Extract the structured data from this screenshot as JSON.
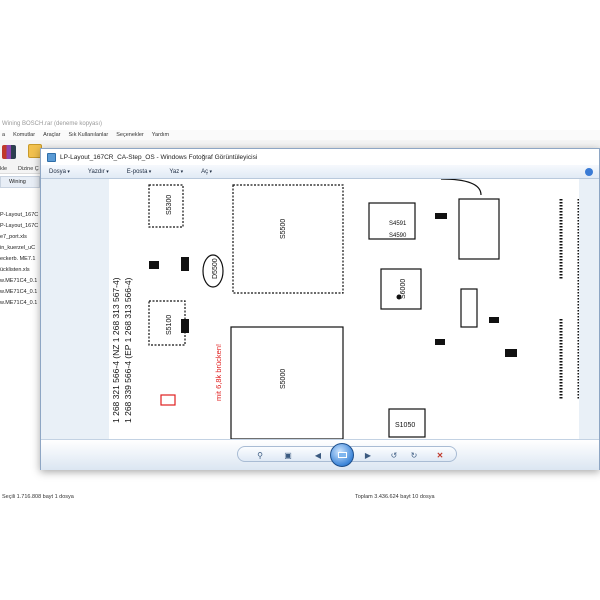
{
  "archive": {
    "title": "Wining BOSCH.rar (deneme kopyası)",
    "menu": [
      "a",
      "Komutlar",
      "Araçlar",
      "Sık Kullanılanlar",
      "Seçenekler",
      "Yardım"
    ],
    "toolbar": {
      "left_label": "kle",
      "middle_label": "Dizine Ç"
    },
    "path_label": "Wining",
    "files": [
      "P-Layout_167C",
      "P-Layout_167C",
      "e7_port.xls",
      "in_kuerzel_uC",
      "eckerb. ME7.1",
      "ücklisten.xls",
      "w.ME71C4_0.1",
      "w.ME71C4_0.1",
      "w.ME71C4_0.1"
    ],
    "status_left": "Seçili 1.716.808 bayt 1 dosya",
    "status_right": "Toplam 3.436.624 bayt 10 dosya"
  },
  "viewer": {
    "title": "LP-Layout_167CR_CA-Step_OS - Windows Fotoğraf Görüntüleyicisi",
    "menu": [
      "Dosya",
      "Yazdır",
      "E-posta",
      "Yaz",
      "Aç"
    ],
    "controls": {
      "zoom": "zoom-icon",
      "fit": "actual-size-icon",
      "prev": "previous-icon",
      "slideshow": "slideshow-icon",
      "next": "next-icon",
      "rotate_ccw": "rotate-counterclockwise-icon",
      "rotate_cw": "rotate-clockwise-icon",
      "delete": "delete-icon"
    }
  },
  "pcb": {
    "part_numbers": [
      "1 268 321 566-4  (NZ 1 268 313 567-4)",
      "1 268 339 566-4  (EP 1 268 313 566-4)"
    ],
    "annotation": "mit 6,8k brücken!",
    "labels": [
      "S5500",
      "S5000",
      "S5300",
      "S5400",
      "S5100",
      "S4000",
      "S6000",
      "S1050",
      "S5200",
      "S5900",
      "D5500",
      "D5000",
      "S4590",
      "S4591"
    ]
  },
  "colors": {
    "accent": "#3d86d9",
    "annotation": "#e02020",
    "viewer_bg": "#e9f0f7"
  }
}
